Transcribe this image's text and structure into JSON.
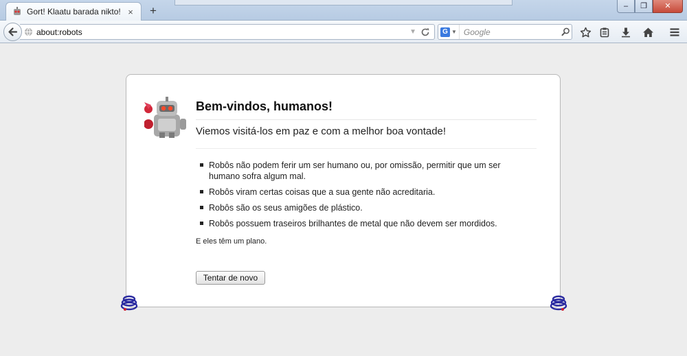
{
  "window": {
    "tab_title": "Gort! Klaatu barada nikto!",
    "tab_close_glyph": "×",
    "new_tab_glyph": "+",
    "controls": {
      "minimize": "–",
      "maximize": "❐",
      "close": "✕"
    }
  },
  "navbar": {
    "url": "about:robots",
    "search_engine": "G",
    "search_placeholder": "Google",
    "icons": [
      "back-arrow-icon",
      "globe-icon",
      "reload-icon",
      "magnifier-icon",
      "star-icon",
      "clipboard-icon",
      "download-icon",
      "home-icon",
      "menu-icon"
    ]
  },
  "page": {
    "title": "Bem-vindos, humanos!",
    "subtitle": "Viemos visitá-los em paz e com a melhor boa vontade!",
    "laws": [
      "Robôs não podem ferir um ser humano ou, por omissão, permitir que um ser humano sofra algum mal.",
      "Robôs viram certas coisas que a sua gente não acreditaria.",
      "Robôs são os seus amigões de plástico.",
      "Robôs possuem traseiros brilhantes de metal que não devem ser mordidos."
    ],
    "plan": "E eles têm um plano.",
    "try_again": "Tentar de novo"
  },
  "colors": {
    "accent": "#3a7ae0",
    "window_frame": "#b7cbe3",
    "close_button": "#c74a3a"
  }
}
